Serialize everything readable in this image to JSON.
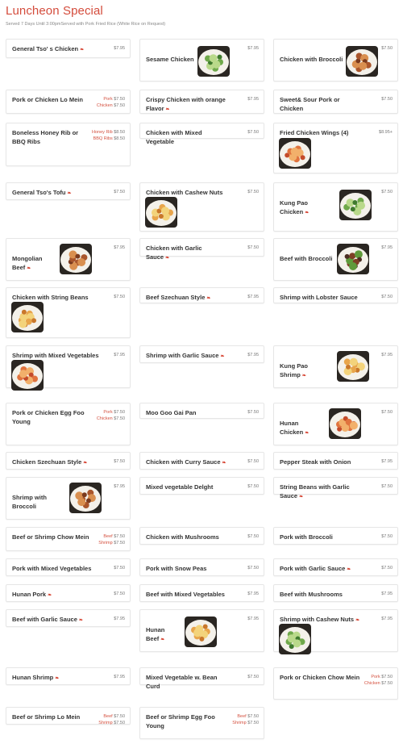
{
  "header": {
    "title": "Luncheon Special",
    "subtitle": "Served 7 Days Until 3:00pmServed with Pork Fried Rice (White Rice on Request)"
  },
  "spicy_icon": "pepper-icon",
  "colors": {
    "accent": "#d44c3c",
    "price": "#777777",
    "border": "#e6e6e6"
  },
  "items": [
    {
      "id": "general-tsos-chicken",
      "name": "General Tso' s Chicken",
      "spicy": true,
      "prices": [
        {
          "label": "",
          "value": "$7.95"
        }
      ],
      "photo": false
    },
    {
      "id": "sesame-chicken",
      "name": "Sesame Chicken",
      "spicy": false,
      "prices": [
        {
          "label": "",
          "value": "$7.95"
        }
      ],
      "photo": true
    },
    {
      "id": "chicken-with-broccoli",
      "name": "Chicken with Broccoli",
      "spicy": false,
      "prices": [
        {
          "label": "",
          "value": "$7.50"
        }
      ],
      "photo": true
    },
    {
      "id": "pork-or-chicken-lo-mein",
      "name": "Pork or Chicken Lo Mein",
      "spicy": false,
      "prices": [
        {
          "label": "Pork",
          "value": "$7.50"
        },
        {
          "label": "Chicken",
          "value": "$7.50"
        }
      ],
      "photo": false
    },
    {
      "id": "crispy-chicken-orange",
      "name": "Crispy Chicken with orange Flavor",
      "spicy": true,
      "prices": [
        {
          "label": "",
          "value": "$7.95"
        }
      ],
      "photo": false
    },
    {
      "id": "sweet-sour-pork-chicken",
      "name": "Sweet& Sour Pork or Chicken",
      "spicy": false,
      "prices": [
        {
          "label": "",
          "value": "$7.50"
        }
      ],
      "photo": false
    },
    {
      "id": "boneless-honey-rib",
      "name": "Boneless Honey Rib or BBQ Ribs",
      "spicy": false,
      "prices": [
        {
          "label": "Honey Rib",
          "value": "$8.50"
        },
        {
          "label": "BBQ Ribs",
          "value": "$8.50"
        }
      ],
      "photo": false
    },
    {
      "id": "chicken-mixed-vegetable",
      "name": "Chicken with Mixed Vegetable",
      "spicy": false,
      "prices": [
        {
          "label": "",
          "value": "$7.50"
        }
      ],
      "photo": false
    },
    {
      "id": "fried-chicken-wings",
      "name": "Fried Chicken Wings (4)",
      "spicy": false,
      "prices": [
        {
          "label": "",
          "value": "$8.95+"
        }
      ],
      "photo": true
    },
    {
      "id": "general-tsos-tofu",
      "name": "General Tso's Tofu",
      "spicy": true,
      "prices": [
        {
          "label": "",
          "value": "$7.50"
        }
      ],
      "photo": false
    },
    {
      "id": "chicken-cashew-nuts",
      "name": "Chicken with Cashew Nuts",
      "spicy": false,
      "prices": [
        {
          "label": "",
          "value": "$7.50"
        }
      ],
      "photo": true
    },
    {
      "id": "kung-pao-chicken",
      "name": "Kung Pao Chicken",
      "spicy": true,
      "prices": [
        {
          "label": "",
          "value": "$7.50"
        }
      ],
      "photo": true
    },
    {
      "id": "mongolian-beef",
      "name": "Mongolian Beef",
      "spicy": true,
      "prices": [
        {
          "label": "",
          "value": "$7.95"
        }
      ],
      "photo": true
    },
    {
      "id": "chicken-garlic-sauce",
      "name": "Chicken with Garlic Sauce",
      "spicy": true,
      "prices": [
        {
          "label": "",
          "value": "$7.50"
        }
      ],
      "photo": false
    },
    {
      "id": "beef-with-broccoli",
      "name": "Beef with Broccoli",
      "spicy": false,
      "prices": [
        {
          "label": "",
          "value": "$7.95"
        }
      ],
      "photo": true
    },
    {
      "id": "chicken-string-beans",
      "name": "Chicken with String Beans",
      "spicy": false,
      "prices": [
        {
          "label": "",
          "value": "$7.50"
        }
      ],
      "photo": true
    },
    {
      "id": "beef-szechuan",
      "name": "Beef Szechuan Style",
      "spicy": true,
      "prices": [
        {
          "label": "",
          "value": "$7.95"
        }
      ],
      "photo": false
    },
    {
      "id": "shrimp-lobster-sauce",
      "name": "Shrimp with Lobster Sauce",
      "spicy": false,
      "prices": [
        {
          "label": "",
          "value": "$7.50"
        }
      ],
      "photo": false
    },
    {
      "id": "shrimp-mixed-vegetables",
      "name": "Shrimp with Mixed Vegetables",
      "spicy": false,
      "prices": [
        {
          "label": "",
          "value": "$7.95"
        }
      ],
      "photo": true
    },
    {
      "id": "shrimp-garlic-sauce",
      "name": "Shrimp with Garlic Sauce",
      "spicy": true,
      "prices": [
        {
          "label": "",
          "value": "$7.95"
        }
      ],
      "photo": false
    },
    {
      "id": "kung-pao-shrimp",
      "name": "Kung Pao Shrimp",
      "spicy": true,
      "prices": [
        {
          "label": "",
          "value": "$7.95"
        }
      ],
      "photo": true
    },
    {
      "id": "egg-foo-young",
      "name": "Pork or Chicken Egg Foo Young",
      "spicy": false,
      "prices": [
        {
          "label": "Pork",
          "value": "$7.50"
        },
        {
          "label": "Chicken",
          "value": "$7.50"
        }
      ],
      "photo": false
    },
    {
      "id": "moo-goo-gai-pan",
      "name": "Moo Goo Gai Pan",
      "spicy": false,
      "prices": [
        {
          "label": "",
          "value": "$7.50"
        }
      ],
      "photo": false
    },
    {
      "id": "hunan-chicken",
      "name": "Hunan Chicken",
      "spicy": true,
      "prices": [
        {
          "label": "",
          "value": "$7.50"
        }
      ],
      "photo": true
    },
    {
      "id": "chicken-szechuan",
      "name": "Chicken Szechuan Style",
      "spicy": true,
      "prices": [
        {
          "label": "",
          "value": "$7.50"
        }
      ],
      "photo": false
    },
    {
      "id": "chicken-curry-sauce",
      "name": "Chicken with Curry Sauce",
      "spicy": true,
      "prices": [
        {
          "label": "",
          "value": "$7.50"
        }
      ],
      "photo": false
    },
    {
      "id": "pepper-steak-onion",
      "name": "Pepper Steak with Onion",
      "spicy": false,
      "prices": [
        {
          "label": "",
          "value": "$7.95"
        }
      ],
      "photo": false
    },
    {
      "id": "shrimp-with-broccoli",
      "name": "Shrimp with Broccoli",
      "spicy": false,
      "prices": [
        {
          "label": "",
          "value": "$7.95"
        }
      ],
      "photo": true
    },
    {
      "id": "mixed-vegetable-delight",
      "name": "Mixed vegetable Delght",
      "spicy": false,
      "prices": [
        {
          "label": "",
          "value": "$7.50"
        }
      ],
      "photo": false
    },
    {
      "id": "string-beans-garlic",
      "name": "String Beans with Garlic Sauce",
      "spicy": true,
      "prices": [
        {
          "label": "",
          "value": "$7.50"
        }
      ],
      "photo": false
    },
    {
      "id": "chow-mein",
      "name": "Beef or Shrimp Chow Mein",
      "spicy": false,
      "prices": [
        {
          "label": "Beef",
          "value": "$7.50"
        },
        {
          "label": "Shrimp",
          "value": "$7.50"
        }
      ],
      "photo": false
    },
    {
      "id": "chicken-mushrooms",
      "name": "Chicken with Mushrooms",
      "spicy": false,
      "prices": [
        {
          "label": "",
          "value": "$7.50"
        }
      ],
      "photo": false
    },
    {
      "id": "pork-with-broccoli",
      "name": "Pork with Broccoli",
      "spicy": false,
      "prices": [
        {
          "label": "",
          "value": "$7.50"
        }
      ],
      "photo": false
    },
    {
      "id": "pork-mixed-vegetables",
      "name": "Pork with Mixed Vegetables",
      "spicy": false,
      "prices": [
        {
          "label": "",
          "value": "$7.50"
        }
      ],
      "photo": false
    },
    {
      "id": "pork-snow-peas",
      "name": "Pork with Snow Peas",
      "spicy": false,
      "prices": [
        {
          "label": "",
          "value": "$7.50"
        }
      ],
      "photo": false
    },
    {
      "id": "pork-garlic-sauce",
      "name": "Pork with Garlic Sauce",
      "spicy": true,
      "prices": [
        {
          "label": "",
          "value": "$7.50"
        }
      ],
      "photo": false
    },
    {
      "id": "hunan-pork",
      "name": "Hunan Pork",
      "spicy": true,
      "prices": [
        {
          "label": "",
          "value": "$7.50"
        }
      ],
      "photo": false
    },
    {
      "id": "beef-mixed-vegetables",
      "name": "Beef with Mixed Vegetables",
      "spicy": false,
      "prices": [
        {
          "label": "",
          "value": "$7.95"
        }
      ],
      "photo": false
    },
    {
      "id": "beef-mushrooms",
      "name": "Beef with Mushrooms",
      "spicy": false,
      "prices": [
        {
          "label": "",
          "value": "$7.95"
        }
      ],
      "photo": false
    },
    {
      "id": "beef-garlic-sauce",
      "name": "Beef with Garlic Sauce",
      "spicy": true,
      "prices": [
        {
          "label": "",
          "value": "$7.95"
        }
      ],
      "photo": false
    },
    {
      "id": "hunan-beef",
      "name": "Hunan Beef",
      "spicy": true,
      "prices": [
        {
          "label": "",
          "value": "$7.95"
        }
      ],
      "photo": true
    },
    {
      "id": "shrimp-cashew-nuts",
      "name": "Shrimp with Cashew Nuts",
      "spicy": true,
      "prices": [
        {
          "label": "",
          "value": "$7.95"
        }
      ],
      "photo": true
    },
    {
      "id": "hunan-shrimp",
      "name": "Hunan Shrimp",
      "spicy": true,
      "prices": [
        {
          "label": "",
          "value": "$7.95"
        }
      ],
      "photo": false
    },
    {
      "id": "mixed-vegetable-bean-curd",
      "name": "Mixed Vegetable w. Bean Curd",
      "spicy": false,
      "prices": [
        {
          "label": "",
          "value": "$7.50"
        }
      ],
      "photo": false
    },
    {
      "id": "pork-chicken-chow-mein",
      "name": "Pork or Chicken Chow Mein",
      "spicy": false,
      "prices": [
        {
          "label": "Pork",
          "value": "$7.50"
        },
        {
          "label": "Chicken",
          "value": "$7.50"
        }
      ],
      "photo": false
    },
    {
      "id": "beef-shrimp-lo-mein",
      "name": "Beef or Shrimp Lo Mein",
      "spicy": false,
      "prices": [
        {
          "label": "Beef",
          "value": "$7.50"
        },
        {
          "label": "Shrimp",
          "value": "$7.50"
        }
      ],
      "photo": false
    },
    {
      "id": "beef-shrimp-egg-foo-young",
      "name": "Beef or Shrimp Egg Foo Young",
      "spicy": false,
      "prices": [
        {
          "label": "Beef",
          "value": "$7.50"
        },
        {
          "label": "Shrimp",
          "value": "$7.50"
        }
      ],
      "photo": false
    }
  ]
}
